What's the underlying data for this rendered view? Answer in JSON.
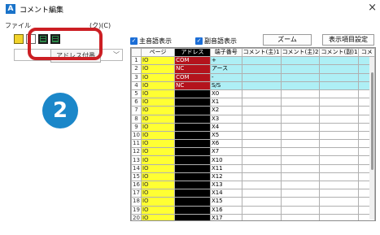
{
  "window": {
    "title": "コメント編集",
    "app_icon": "A",
    "close": "×"
  },
  "menu": {
    "file": "ファイル",
    "display": "(ク)(C)"
  },
  "tooltip": "アドレス付番",
  "step_badge": "2",
  "controls": {
    "main_checkbox_label": "主音語表示",
    "sub_checkbox_label": "副音語表示",
    "zoom_button": "ズーム",
    "settings_button": "表示項目設定"
  },
  "grid": {
    "headers": [
      "",
      "ページ",
      "アドレス",
      "端子番号",
      "コメント(主)1",
      "コメント(主)2",
      "コメント(副)1",
      "コメ"
    ],
    "rows": [
      [
        "1",
        "IO",
        "COM",
        "+"
      ],
      [
        "2",
        "IO",
        "NC",
        "アース"
      ],
      [
        "3",
        "IO",
        "COM",
        "-"
      ],
      [
        "4",
        "IO",
        "NC",
        "S/S"
      ],
      [
        "5",
        "IO",
        "",
        "X0"
      ],
      [
        "6",
        "IO",
        "",
        "X1"
      ],
      [
        "7",
        "IO",
        "",
        "X2"
      ],
      [
        "8",
        "IO",
        "",
        "X3"
      ],
      [
        "9",
        "IO",
        "",
        "X4"
      ],
      [
        "10",
        "IO",
        "",
        "X5"
      ],
      [
        "11",
        "IO",
        "",
        "X6"
      ],
      [
        "12",
        "IO",
        "",
        "X7"
      ],
      [
        "13",
        "IO",
        "",
        "X10"
      ],
      [
        "14",
        "IO",
        "",
        "X11"
      ],
      [
        "15",
        "IO",
        "",
        "X12"
      ],
      [
        "16",
        "IO",
        "",
        "X13"
      ],
      [
        "17",
        "IO",
        "",
        "X14"
      ],
      [
        "18",
        "IO",
        "",
        "X15"
      ],
      [
        "19",
        "IO",
        "",
        "X16"
      ],
      [
        "20",
        "IO",
        "",
        "X17"
      ]
    ]
  },
  "colors": {
    "page_column": "#ffff33",
    "address_column": "#000000",
    "address_highlight": "#b4131c",
    "highlight_rows": "#aeeff5",
    "highlight_box": "#cc1f24",
    "badge": "#1b87c9"
  }
}
